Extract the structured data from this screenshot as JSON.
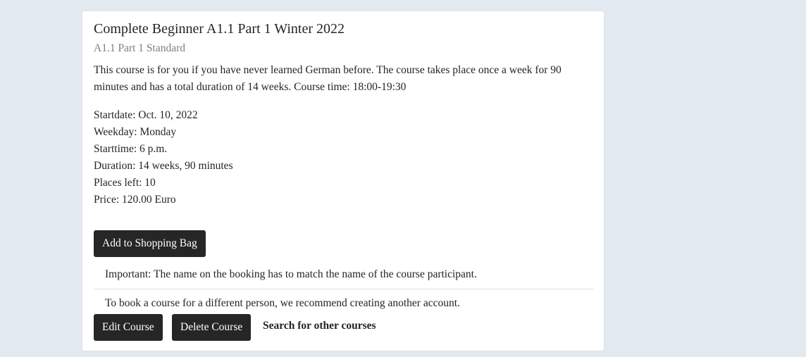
{
  "course": {
    "title": "Complete Beginner A1.1 Part 1 Winter 2022",
    "subtitle": "A1.1 Part 1 Standard",
    "description": "This course is for you if you have never learned German before. The course takes place once a week for 90 minutes and has a total duration of 14 weeks. Course time: 18:00-19:30",
    "details": [
      "Startdate: Oct. 10, 2022",
      "Weekday: Monday",
      "Starttime: 6 p.m.",
      "Duration: 14 weeks, 90 minutes",
      "Places left: 10",
      "Price: 120.00 Euro"
    ]
  },
  "actions": {
    "add_to_bag": "Add to Shopping Bag",
    "edit": "Edit Course",
    "delete": "Delete Course",
    "search": "Search for other courses"
  },
  "notes": [
    "Important: The name on the booking has to match the name of the course participant.",
    "To book a course for a different person, we recommend creating another account."
  ]
}
